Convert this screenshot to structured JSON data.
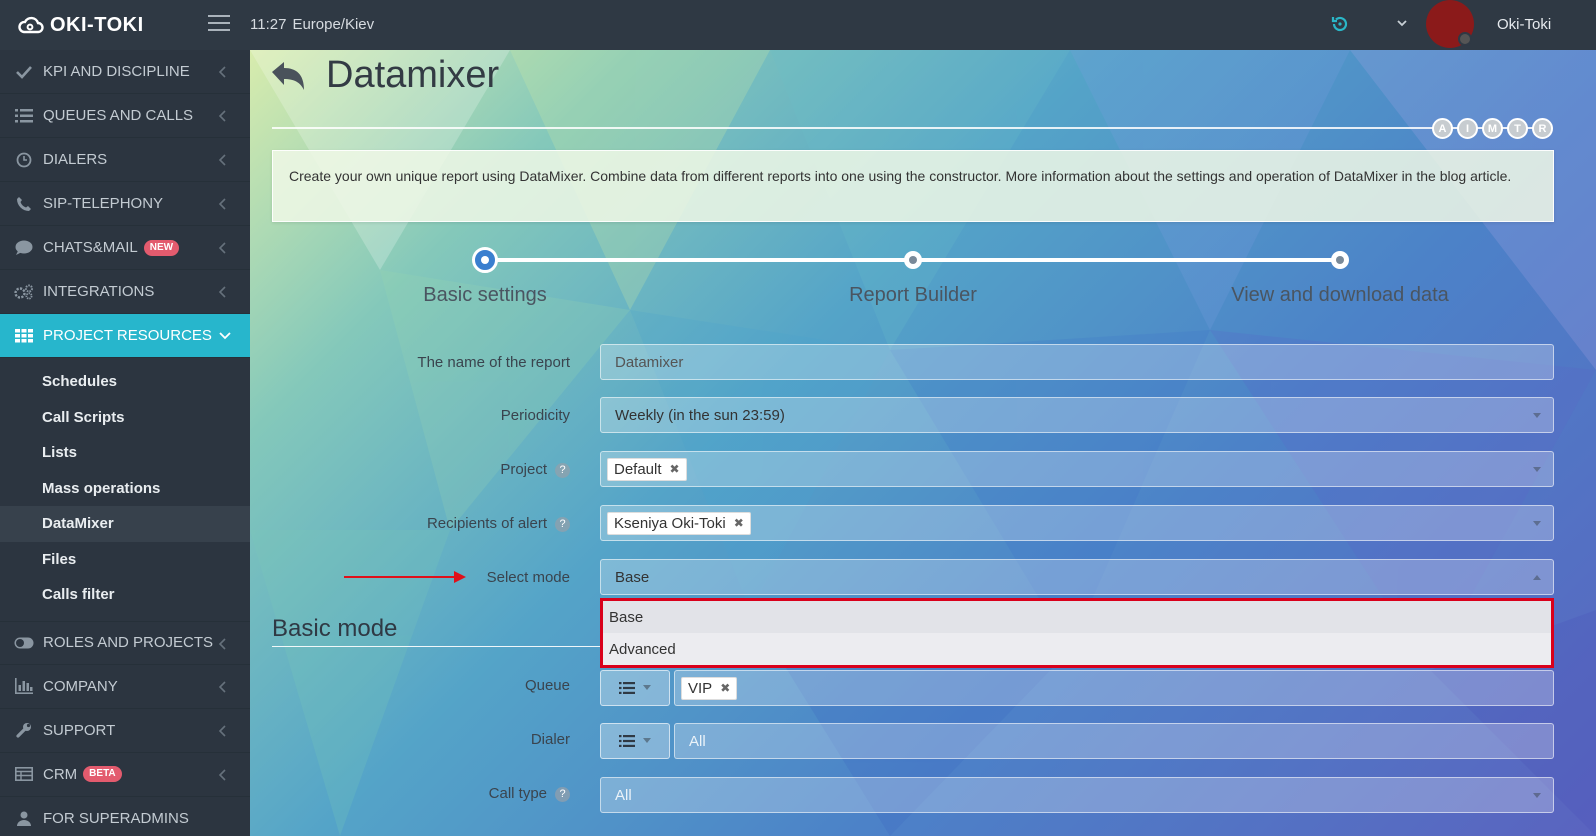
{
  "topbar": {
    "logo_text": "OKI-TOKI",
    "time": "11:27",
    "timezone": "Europe/Kiev",
    "user_name": "Oki-Toki"
  },
  "sidebar": {
    "items": [
      {
        "label": "KPI AND DISCIPLINE",
        "icon": "check-icon"
      },
      {
        "label": "QUEUES AND CALLS",
        "icon": "list-icon"
      },
      {
        "label": "DIALERS",
        "icon": "clock-icon"
      },
      {
        "label": "SIP-TELEPHONY",
        "icon": "phone-icon"
      },
      {
        "label": "CHATS&MAIL",
        "icon": "chat-icon",
        "badge": "NEW"
      },
      {
        "label": "INTEGRATIONS",
        "icon": "cogs-icon"
      },
      {
        "label": "PROJECT RESOURCES",
        "icon": "grid-icon",
        "active": true
      }
    ],
    "submenu": [
      "Schedules",
      "Call Scripts",
      "Lists",
      "Mass operations",
      "DataMixer",
      "Files",
      "Calls filter"
    ],
    "items_after": [
      {
        "label": "ROLES AND PROJECTS",
        "icon": "toggle-icon"
      },
      {
        "label": "COMPANY",
        "icon": "bar-chart-icon"
      },
      {
        "label": "SUPPORT",
        "icon": "wrench-icon"
      },
      {
        "label": "CRM",
        "icon": "table-icon",
        "badge": "BETA"
      },
      {
        "label": "FOR SUPERADMINS",
        "icon": "user-icon"
      }
    ]
  },
  "page": {
    "title": "Datamixer",
    "circles": [
      "A",
      "I",
      "M",
      "T",
      "R"
    ],
    "info": "Create your own unique report using DataMixer. Combine data from different reports into one using the constructor. More information about the settings and operation of DataMixer in the blog article."
  },
  "steps": [
    "Basic settings",
    "Report Builder",
    "View and download data"
  ],
  "form": {
    "report_name_label": "The name of the report",
    "report_name_value": "Datamixer",
    "periodicity_label": "Periodicity",
    "periodicity_value": "Weekly (in the sun 23:59)",
    "project_label": "Project",
    "project_tag": "Default",
    "recipients_label": "Recipients of alert",
    "recipients_tag": "Kseniya Oki-Toki",
    "select_mode_label": "Select mode",
    "select_mode_value": "Base",
    "mode_options": [
      "Base",
      "Advanced"
    ],
    "basic_mode_title": "Basic mode",
    "queue_label": "Queue",
    "queue_tag": "VIP",
    "dialer_label": "Dialer",
    "dialer_placeholder": "All",
    "call_type_label": "Call type",
    "call_type_placeholder": "All"
  },
  "colors": {
    "accent": "#27b6cc",
    "sidebar_bg": "#2c3540",
    "highlight_border": "#d9001b",
    "badge": "#e35b6e"
  }
}
